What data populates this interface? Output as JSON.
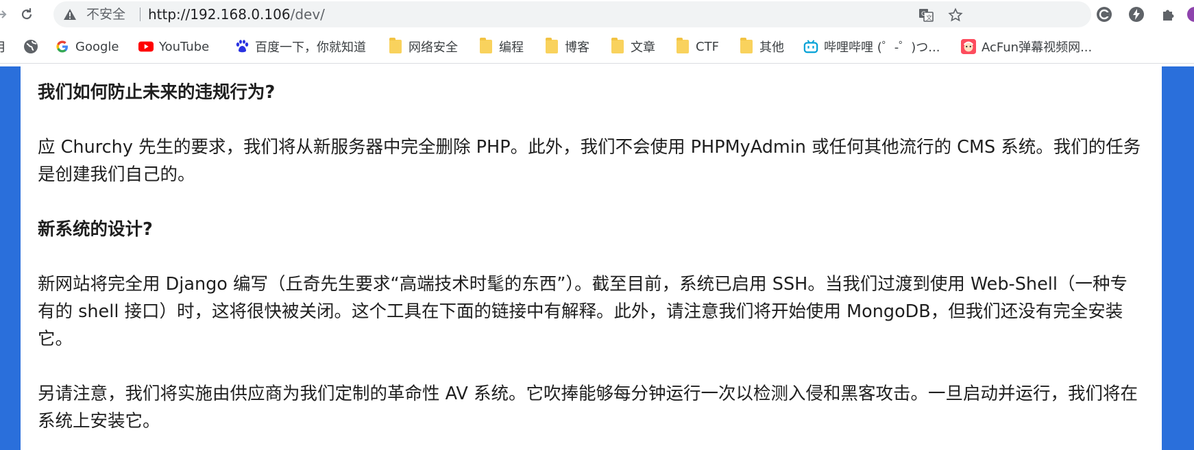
{
  "browser": {
    "omnibox": {
      "security_label": "不安全",
      "url_host": "http://192.168.0.106",
      "url_path": "/dev/"
    },
    "bookmarks": [
      {
        "label": "",
        "icon": "globe-icon"
      },
      {
        "label": "Google",
        "icon": "google-icon"
      },
      {
        "label": "YouTube",
        "icon": "youtube-icon"
      },
      {
        "label": "百度一下，你就知道",
        "icon": "baidu-icon"
      },
      {
        "label": "网络安全",
        "icon": "folder-icon"
      },
      {
        "label": "编程",
        "icon": "folder-icon"
      },
      {
        "label": "博客",
        "icon": "folder-icon"
      },
      {
        "label": "文章",
        "icon": "folder-icon"
      },
      {
        "label": "CTF",
        "icon": "folder-icon"
      },
      {
        "label": "其他",
        "icon": "folder-icon"
      },
      {
        "label": "哔哩哔哩 (゜-゜)つ...",
        "icon": "bilibili-icon"
      },
      {
        "label": "AcFun弹幕视频网...",
        "icon": "acfun-icon"
      }
    ],
    "bookmark_edge_label": "月"
  },
  "page": {
    "heading1": "我们如何防止未来的违规行为?",
    "para1": "应 Churchy 先生的要求，我们将从新服务器中完全删除 PHP。此外，我们不会使用 PHPMyAdmin 或任何其他流行的 CMS 系统。我们的任务是创建我们自己的。",
    "heading2": "新系统的设计?",
    "para2": "新网站将完全用 Django 编写（丘奇先生要求“高端技术时髦的东西”）。截至目前，系统已启用 SSH。当我们过渡到使用 Web-Shell（一种专有的 shell 接口）时，这将很快被关闭。这个工具在下面的链接中有解释。此外，请注意我们将开始使用 MongoDB，但我们还没有完全安装它。",
    "para3": "另请注意，我们将实施由供应商为我们定制的革命性 AV 系统。它吹捧能够每分钟运行一次以检测入侵和黑客攻击。一旦启动并运行，我们将在系统上安装它。"
  },
  "colors": {
    "page_background": "#2a6fdb",
    "panel": "#ffffff",
    "folder": "#f9d25d"
  }
}
